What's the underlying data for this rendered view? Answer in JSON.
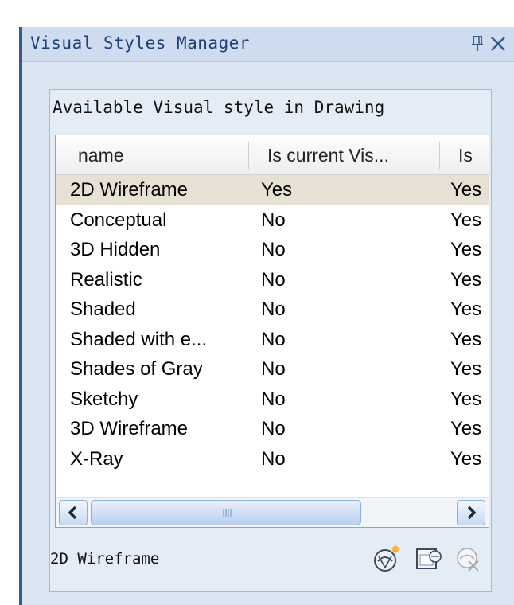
{
  "palette": {
    "title": "Visual Styles Manager"
  },
  "group": {
    "title": "Available Visual style in Drawing"
  },
  "list": {
    "columns": [
      "name",
      "Is current Vis...",
      "Is"
    ],
    "rows": [
      {
        "name": "2D Wireframe",
        "current": "Yes",
        "col3": "Yes"
      },
      {
        "name": "Conceptual",
        "current": "No",
        "col3": "Yes"
      },
      {
        "name": "3D Hidden",
        "current": "No",
        "col3": "Yes"
      },
      {
        "name": "Realistic",
        "current": "No",
        "col3": "Yes"
      },
      {
        "name": "Shaded",
        "current": "No",
        "col3": "Yes"
      },
      {
        "name": "Shaded with e...",
        "current": "No",
        "col3": "Yes"
      },
      {
        "name": "Shades of Gray",
        "current": "No",
        "col3": "Yes"
      },
      {
        "name": "Sketchy",
        "current": "No",
        "col3": "Yes"
      },
      {
        "name": "3D Wireframe",
        "current": "No",
        "col3": "Yes"
      },
      {
        "name": "X-Ray",
        "current": "No",
        "col3": "Yes"
      }
    ],
    "selected_index": 0
  },
  "status": {
    "current_style": "2D Wireframe"
  },
  "icons": {
    "pin": "pin-icon",
    "close": "close-icon",
    "create": "create-visual-style-icon",
    "apply": "apply-to-viewport-icon",
    "delete": "delete-visual-style-icon"
  },
  "colors": {
    "title_text": "#1c3f7a",
    "palette_bg": "#dbe6f3",
    "selected_row": "#e7e1d5"
  }
}
